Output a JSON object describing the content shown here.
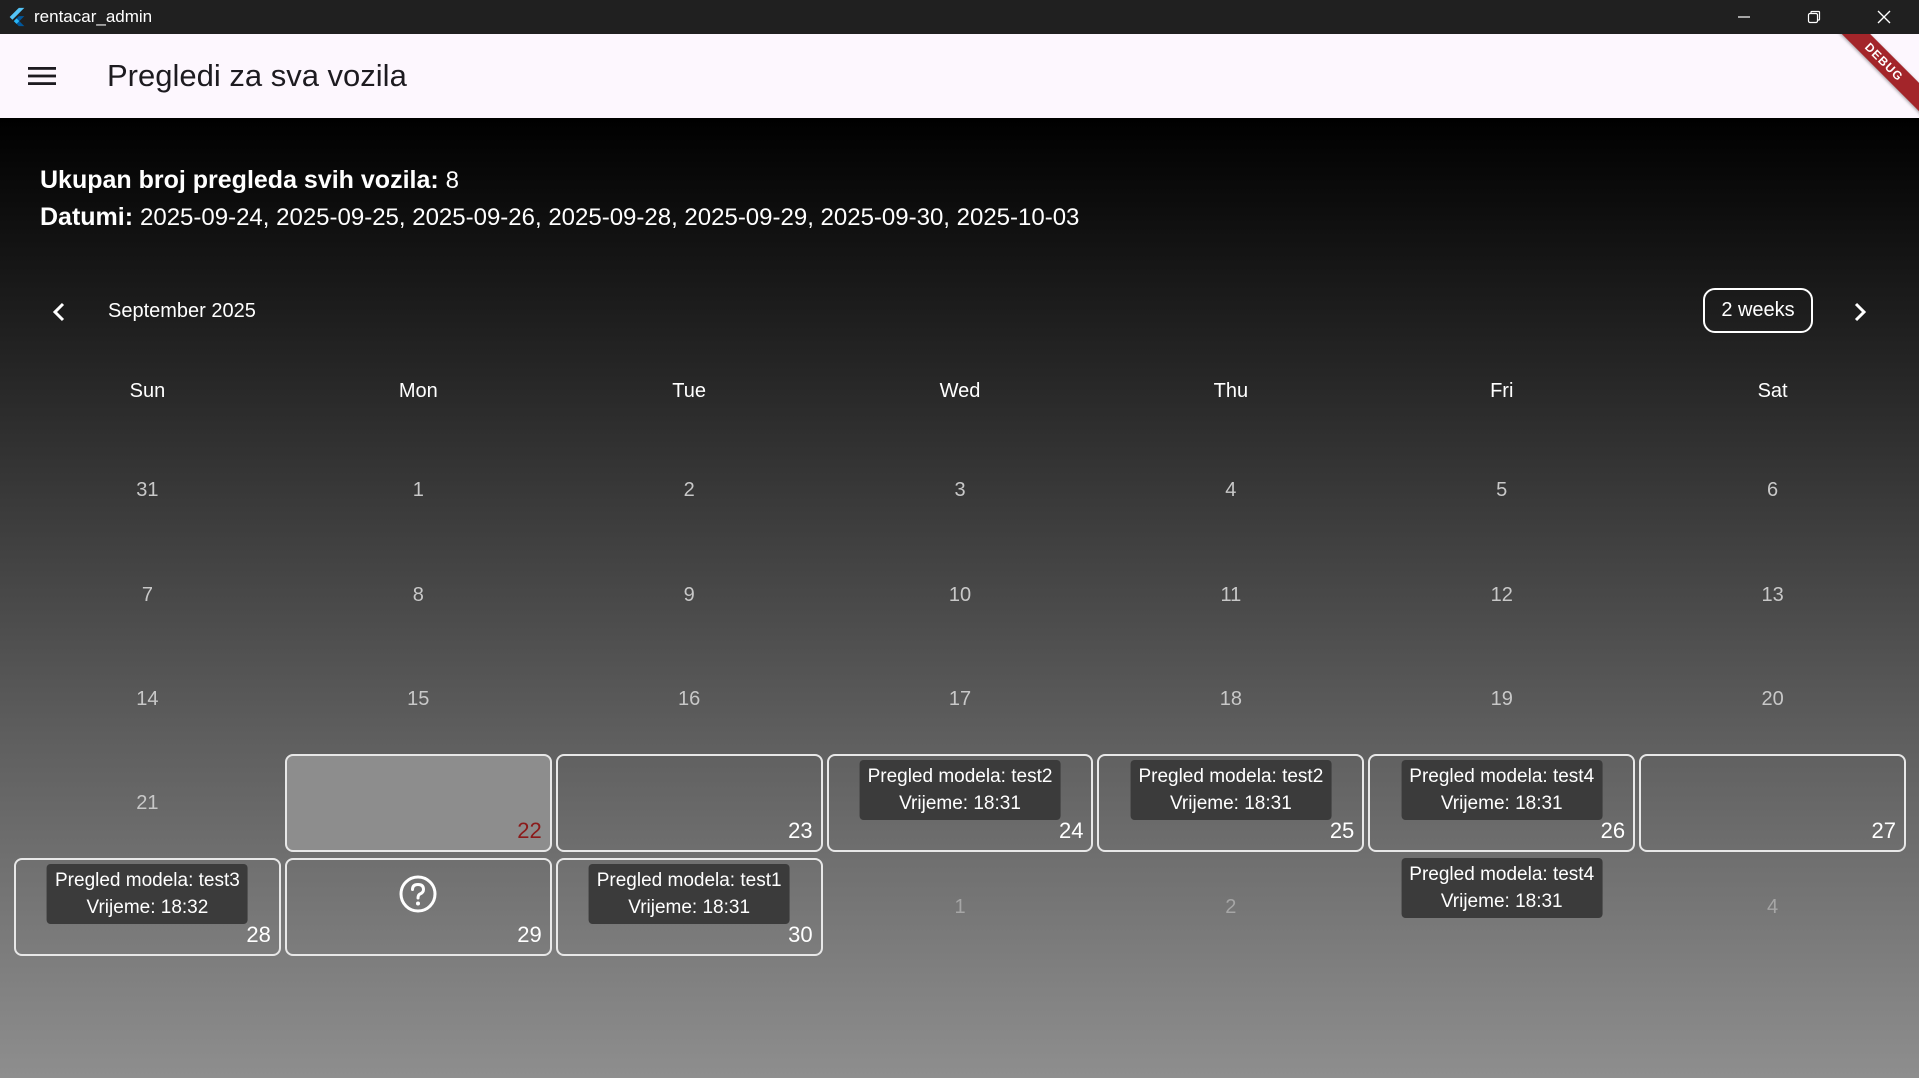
{
  "window": {
    "title": "rentacar_admin"
  },
  "appbar": {
    "title": "Pregledi za sva vozila",
    "debug_banner": "DEBUG"
  },
  "summary": {
    "total_label": "Ukupan broj pregleda svih vozila:",
    "total_value": "8",
    "dates_label": "Datumi:",
    "dates_value": "2025-09-24, 2025-09-25, 2025-09-26, 2025-09-28, 2025-09-29, 2025-09-30, 2025-10-03"
  },
  "calendar": {
    "month_title": "September 2025",
    "format_button": "2 weeks",
    "weekdays": [
      "Sun",
      "Mon",
      "Tue",
      "Wed",
      "Thu",
      "Fri",
      "Sat"
    ],
    "weeks": [
      {
        "days": [
          {
            "num": "31"
          },
          {
            "num": "1"
          },
          {
            "num": "2"
          },
          {
            "num": "3"
          },
          {
            "num": "4"
          },
          {
            "num": "5"
          },
          {
            "num": "6"
          }
        ]
      },
      {
        "days": [
          {
            "num": "7"
          },
          {
            "num": "8"
          },
          {
            "num": "9"
          },
          {
            "num": "10"
          },
          {
            "num": "11"
          },
          {
            "num": "12"
          },
          {
            "num": "13"
          }
        ]
      },
      {
        "days": [
          {
            "num": "14"
          },
          {
            "num": "15"
          },
          {
            "num": "16"
          },
          {
            "num": "17"
          },
          {
            "num": "18"
          },
          {
            "num": "19"
          },
          {
            "num": "20"
          }
        ]
      },
      {
        "days": [
          {
            "num": "21"
          },
          {
            "num": "22",
            "boxed": true,
            "today": true
          },
          {
            "num": "23",
            "boxed": true
          },
          {
            "num": "24",
            "boxed": true,
            "event": {
              "line1": "Pregled modela: test2",
              "line2": "Vrijeme: 18:31"
            }
          },
          {
            "num": "25",
            "boxed": true,
            "event": {
              "line1": "Pregled modela: test2",
              "line2": "Vrijeme: 18:31"
            }
          },
          {
            "num": "26",
            "boxed": true,
            "event": {
              "line1": "Pregled modela: test4",
              "line2": "Vrijeme: 18:31"
            }
          },
          {
            "num": "27",
            "boxed": true
          }
        ]
      },
      {
        "days": [
          {
            "num": "28",
            "boxed": true,
            "event": {
              "line1": "Pregled modela: test3",
              "line2": "Vrijeme: 18:32"
            }
          },
          {
            "num": "29",
            "boxed": true,
            "help_icon": true
          },
          {
            "num": "30",
            "boxed": true,
            "event": {
              "line1": "Pregled modela: test1",
              "line2": "Vrijeme: 18:31"
            }
          },
          {
            "num": "1",
            "outside": true
          },
          {
            "num": "2",
            "outside": true
          },
          {
            "num": "",
            "outside": true,
            "event": {
              "line1": "Pregled modela: test4",
              "line2": "Vrijeme: 18:31"
            }
          },
          {
            "num": "4",
            "outside": true
          }
        ]
      }
    ]
  }
}
